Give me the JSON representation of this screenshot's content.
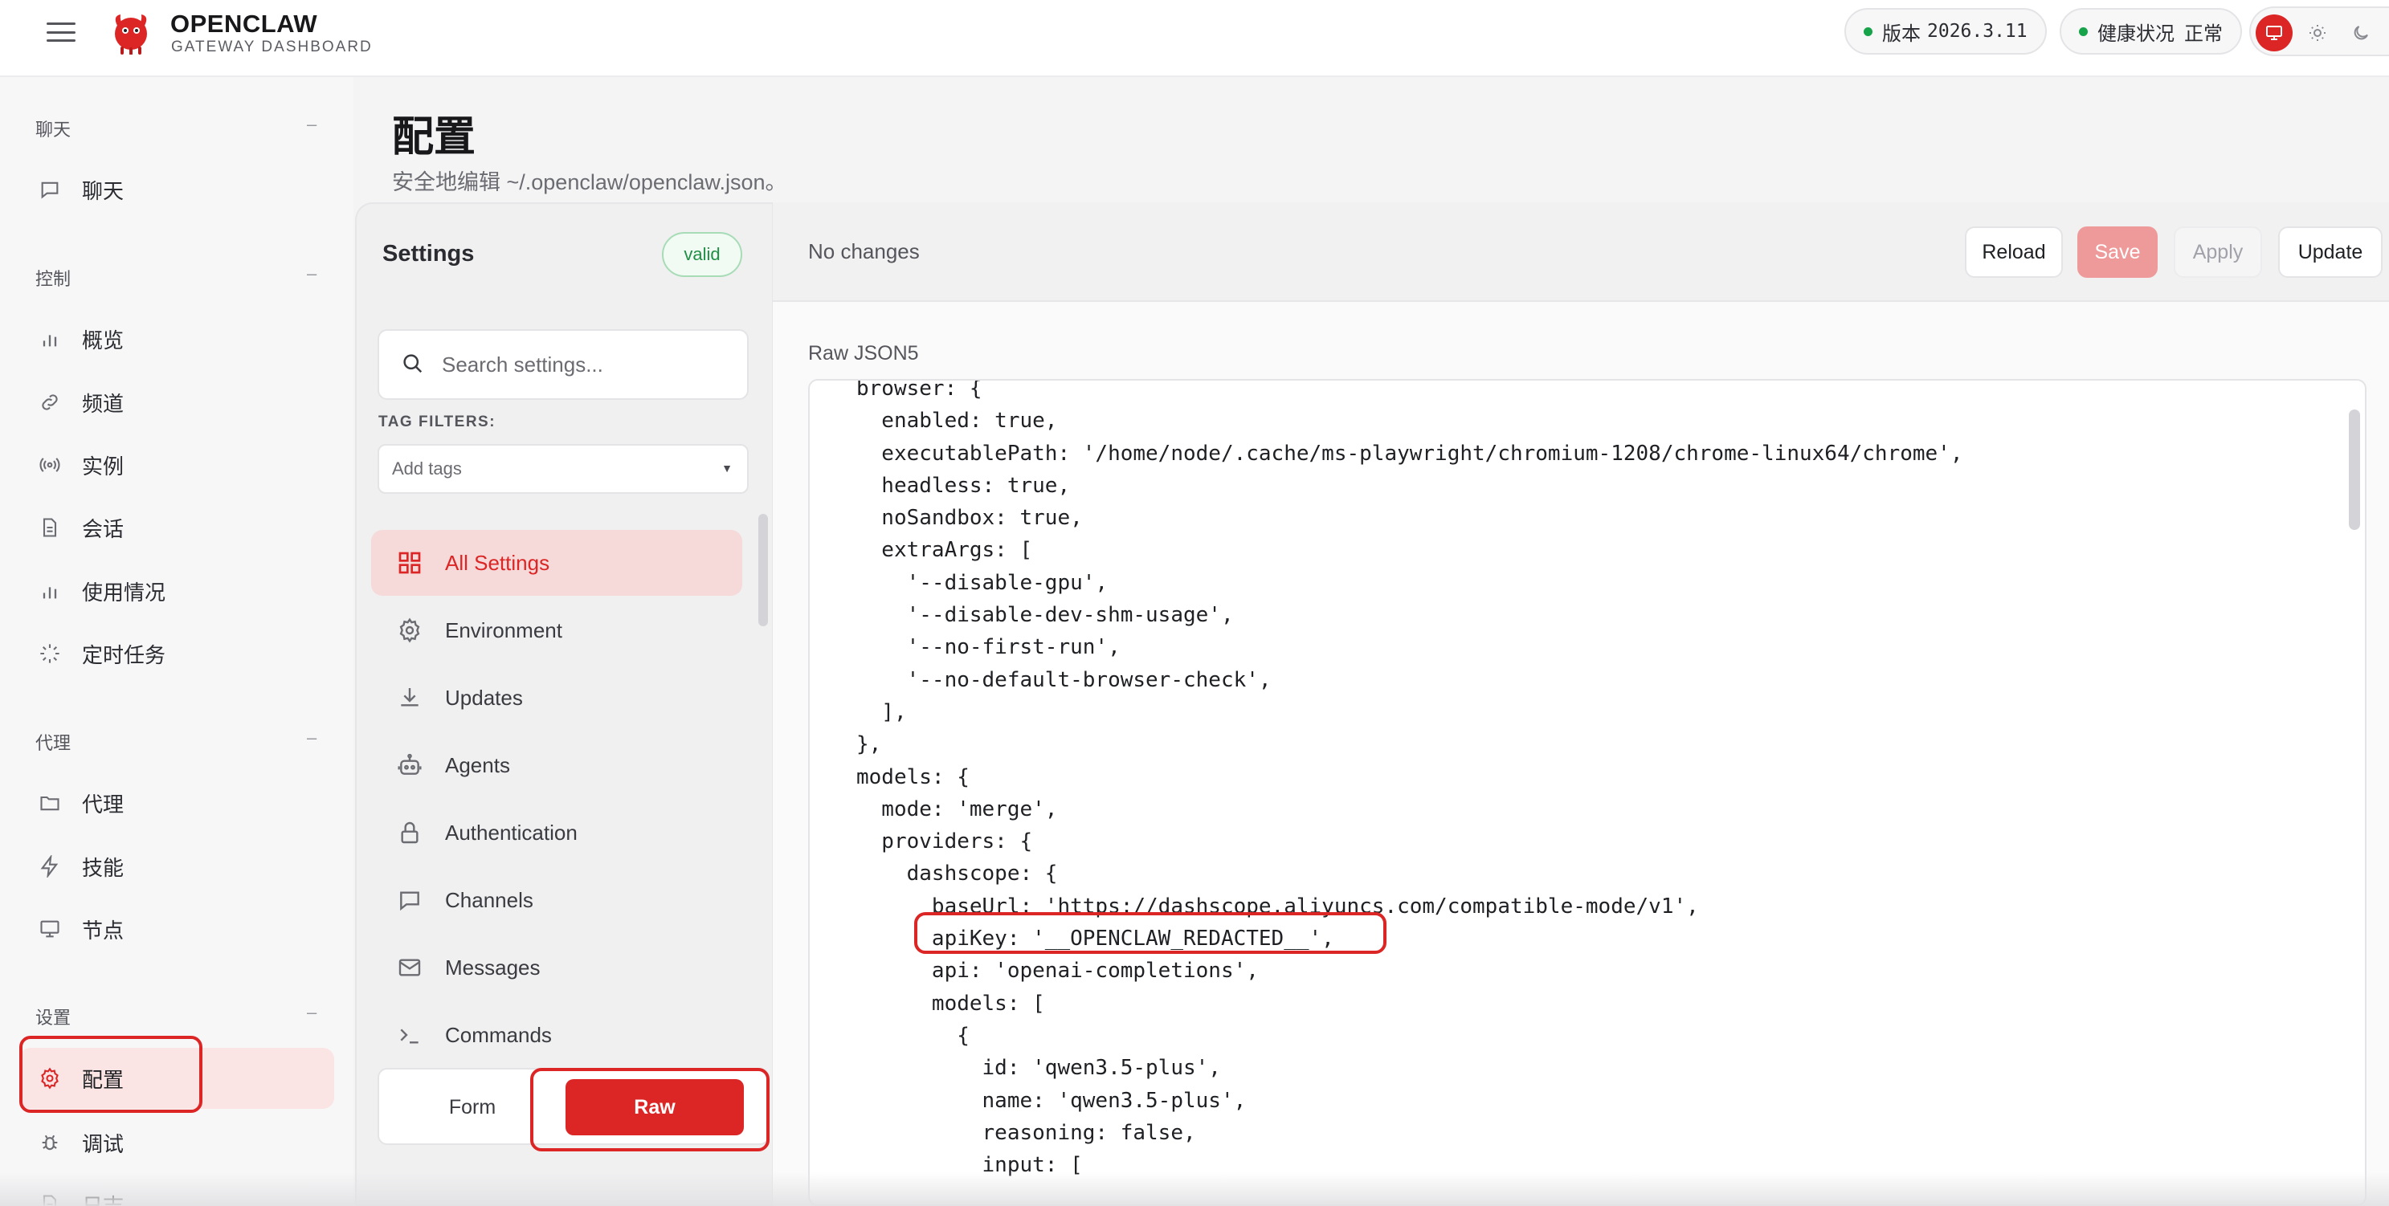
{
  "header": {
    "brand_title": "OPENCLAW",
    "brand_subtitle": "GATEWAY DASHBOARD",
    "version_label": "版本",
    "version_value": "2026.3.11",
    "health_label": "健康状况",
    "health_value": "正常",
    "status_color": "#16a34a",
    "accent_color": "#dc2626"
  },
  "sidebar": {
    "sections": [
      {
        "title": "聊天",
        "items": [
          {
            "label": "聊天",
            "icon": "chat-bubble-icon"
          }
        ]
      },
      {
        "title": "控制",
        "items": [
          {
            "label": "概览",
            "icon": "bar-chart-icon"
          },
          {
            "label": "频道",
            "icon": "link-icon"
          },
          {
            "label": "实例",
            "icon": "radio-signal-icon"
          },
          {
            "label": "会话",
            "icon": "document-icon"
          },
          {
            "label": "使用情况",
            "icon": "bar-chart-icon"
          },
          {
            "label": "定时任务",
            "icon": "loader-icon"
          }
        ]
      },
      {
        "title": "代理",
        "items": [
          {
            "label": "代理",
            "icon": "folder-icon"
          },
          {
            "label": "技能",
            "icon": "lightning-icon"
          },
          {
            "label": "节点",
            "icon": "monitor-icon"
          }
        ]
      },
      {
        "title": "设置",
        "items": [
          {
            "label": "配置",
            "icon": "gear-icon",
            "active": true
          },
          {
            "label": "调试",
            "icon": "bug-icon"
          },
          {
            "label": "日志",
            "icon": "document-icon"
          }
        ]
      }
    ],
    "collapse_symbol": "–"
  },
  "page": {
    "title": "配置",
    "subtitle": "安全地编辑 ~/.openclaw/openclaw.json。"
  },
  "settings": {
    "heading": "Settings",
    "badge": "valid",
    "search_placeholder": "Search settings...",
    "tag_filters_label": "TAG FILTERS:",
    "tag_placeholder": "Add tags",
    "categories": [
      {
        "label": "All Settings",
        "icon": "grid-icon",
        "active": true
      },
      {
        "label": "Environment",
        "icon": "gear-icon"
      },
      {
        "label": "Updates",
        "icon": "download-icon"
      },
      {
        "label": "Agents",
        "icon": "robot-icon"
      },
      {
        "label": "Authentication",
        "icon": "lock-icon"
      },
      {
        "label": "Channels",
        "icon": "chat-bubble-icon"
      },
      {
        "label": "Messages",
        "icon": "mail-icon"
      },
      {
        "label": "Commands",
        "icon": "terminal-icon"
      }
    ],
    "mode_form": "Form",
    "mode_raw": "Raw",
    "active_mode": "Raw"
  },
  "editor": {
    "status": "No changes",
    "reload_label": "Reload",
    "save_label": "Save",
    "apply_label": "Apply",
    "update_label": "Update",
    "raw_label": "Raw JSON5",
    "code_lines": [
      "browser: {",
      "  enabled: true,",
      "  executablePath: '/home/node/.cache/ms-playwright/chromium-1208/chrome-linux64/chrome',",
      "  headless: true,",
      "  noSandbox: true,",
      "  extraArgs: [",
      "    '--disable-gpu',",
      "    '--disable-dev-shm-usage',",
      "    '--no-first-run',",
      "    '--no-default-browser-check',",
      "  ],",
      "},",
      "models: {",
      "  mode: 'merge',",
      "  providers: {",
      "    dashscope: {",
      "      baseUrl: 'https://dashscope.aliyuncs.com/compatible-mode/v1',",
      "      apiKey: '__OPENCLAW_REDACTED__',",
      "      api: 'openai-completions',",
      "      models: [",
      "        {",
      "          id: 'qwen3.5-plus',",
      "          name: 'qwen3.5-plus',",
      "          reasoning: false,",
      "          input: ["
    ]
  }
}
